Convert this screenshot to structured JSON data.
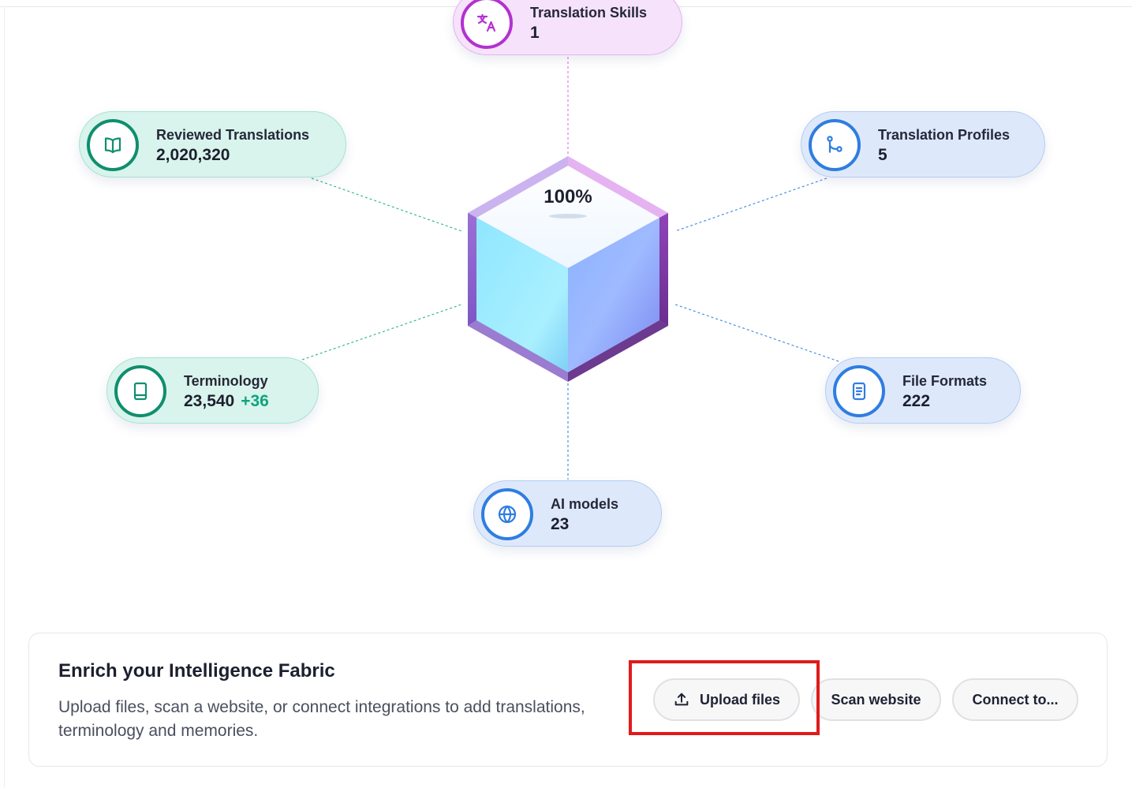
{
  "nodes": {
    "translation_skills": {
      "label": "Translation Skills",
      "value": "1",
      "icon": "translate-icon"
    },
    "reviewed_translations": {
      "label": "Reviewed Translations",
      "value": "2,020,320",
      "icon": "book-open-icon"
    },
    "translation_profiles": {
      "label": "Translation Profiles",
      "value": "5",
      "icon": "branch-icon"
    },
    "terminology": {
      "label": "Terminology",
      "value": "23,540",
      "delta": "+36",
      "icon": "book-icon"
    },
    "file_formats": {
      "label": "File Formats",
      "value": "222",
      "icon": "document-icon"
    },
    "ai_models": {
      "label": "AI models",
      "value": "23",
      "icon": "globe-icon"
    }
  },
  "cube": {
    "percent": "100%"
  },
  "enrich": {
    "title": "Enrich your Intelligence Fabric",
    "description": "Upload files, scan a website, or connect integrations to add translations, terminology and memories.",
    "buttons": {
      "upload": "Upload files",
      "scan": "Scan website",
      "connect": "Connect to..."
    }
  },
  "colors": {
    "green_accent": "#0f8f6e",
    "blue_accent": "#2f7de1",
    "pink_accent": "#b331d0",
    "highlight": "#e01b1b"
  }
}
